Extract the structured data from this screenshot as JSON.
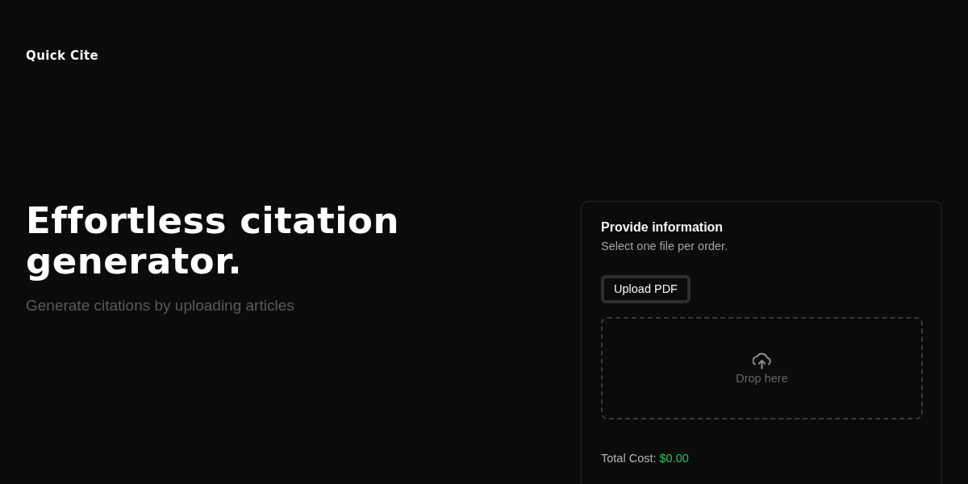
{
  "header": {
    "logo": "Quick Cite"
  },
  "hero": {
    "title": "Effortless citation generator.",
    "subtitle": "Generate citations by uploading articles"
  },
  "card": {
    "title": "Provide information",
    "subtitle": "Select one file per order.",
    "upload_button": "Upload PDF",
    "dropzone": {
      "label": "Drop here"
    },
    "total": {
      "label": "Total Cost:",
      "value": "$0.00"
    }
  }
}
